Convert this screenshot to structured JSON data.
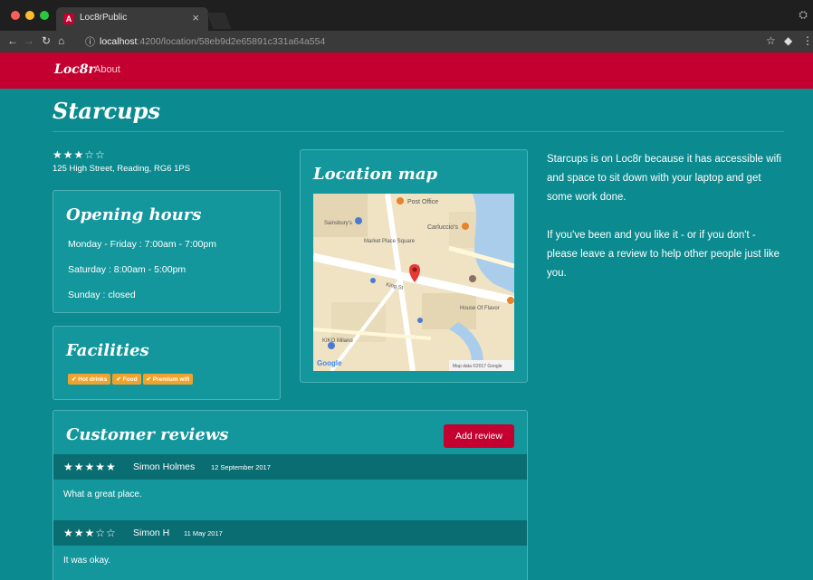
{
  "browser": {
    "tab_title": "Loc8rPublic",
    "tab_close": "×",
    "tab_favicon": "A",
    "url_host": "localhost",
    "url_rest": ":4200/location/58eb9d2e65891c331a64a554",
    "icons": [
      "back-icon",
      "forward-icon",
      "reload-icon",
      "home-icon",
      "info-icon",
      "bookmark-star-icon",
      "extension-icon",
      "menu-icon"
    ]
  },
  "navbar": {
    "brand": "Loc8r",
    "about": "About"
  },
  "location": {
    "name": "Starcups",
    "rating_stars": "★★★☆☆",
    "rating": 3,
    "address": "125 High Street, Reading, RG6 1PS"
  },
  "opening_hours": {
    "title": "Opening hours",
    "lines": [
      "Monday - Friday : 7:00am - 7:00pm",
      "Saturday : 8:00am - 5:00pm",
      "Sunday : closed"
    ]
  },
  "facilities": {
    "title": "Facilities",
    "items": [
      "✔ Hot drinks",
      "✔ Food",
      "✔ Premium wifi"
    ]
  },
  "map": {
    "title": "Location map",
    "labels": [
      "Post Office",
      "Carluccio's",
      "Sainsbury's",
      "Market Place Square",
      "King St",
      "House Of Flavor",
      "KIKO Milano",
      "Google",
      "Map data ©2017 Google"
    ]
  },
  "description": {
    "paragraphs": [
      "Starcups is on Loc8r because it has accessible wifi and space to sit down with your laptop and get some work done.",
      "If you've been and you like it - or if you don't - please leave a review to help other people just like you."
    ]
  },
  "reviews": {
    "title": "Customer reviews",
    "add_label": "Add review",
    "items": [
      {
        "stars": "★★★★★",
        "rating": 5,
        "author": "Simon Holmes",
        "date": "12 September 2017",
        "text": "What a great place."
      },
      {
        "stars": "★★★☆☆",
        "rating": 3,
        "author": "Simon H",
        "date": "11 May 2017",
        "text": "It was okay."
      }
    ]
  },
  "colors": {
    "brand_red": "#c3002f",
    "page_teal": "#0b8a8f",
    "panel_teal": "#13979c",
    "review_header": "#0a6d72",
    "badge_orange": "#f0a32c"
  }
}
